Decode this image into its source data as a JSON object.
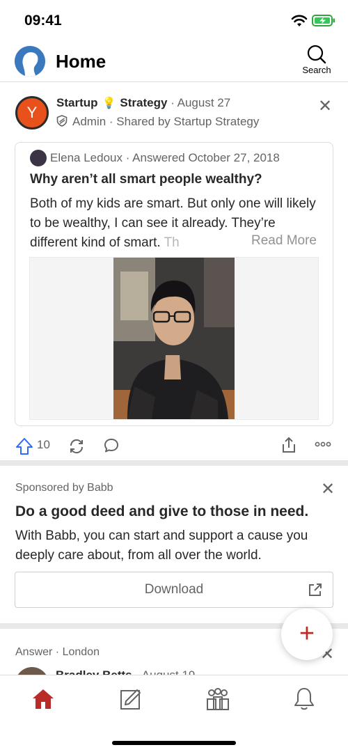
{
  "status_bar": {
    "time": "09:41"
  },
  "header": {
    "title": "Home",
    "search_label": "Search"
  },
  "post": {
    "avatar_letter": "Y",
    "space_name_a": "Startup",
    "space_name_b": "Strategy",
    "date": "· August 27",
    "role_line": "Admin · Shared by Startup Strategy",
    "quote": {
      "author_line": "Elena Ledoux · Answered October 27, 2018",
      "question": "Why aren’t all smart people wealthy?",
      "body_main": "Both of my kids are smart. But only one will likely to be wealthy, I can see it already. They’re different kind of smart. ",
      "body_fade": "Th",
      "read_more": "Read More"
    },
    "upvotes": "10"
  },
  "ad": {
    "sponsor": "Sponsored by Babb",
    "headline": "Do a good deed and give to those in need.",
    "body": "With Babb, you can start and support a cause you deeply care about, from all over the world.",
    "button": "Download"
  },
  "next_item": {
    "meta": "Answer · London",
    "author": "Bradley Betts",
    "date": "· August 19"
  },
  "colors": {
    "brand_red": "#b92b27",
    "upvote_blue": "#2e69ff"
  },
  "icons": [
    "wifi-icon",
    "battery-icon",
    "search-icon",
    "close-icon",
    "shield-icon",
    "upvote-icon",
    "reshare-icon",
    "comment-icon",
    "share-icon",
    "more-icon",
    "external-link-icon",
    "plus-icon",
    "home-icon",
    "write-icon",
    "spaces-icon",
    "notifications-icon"
  ]
}
